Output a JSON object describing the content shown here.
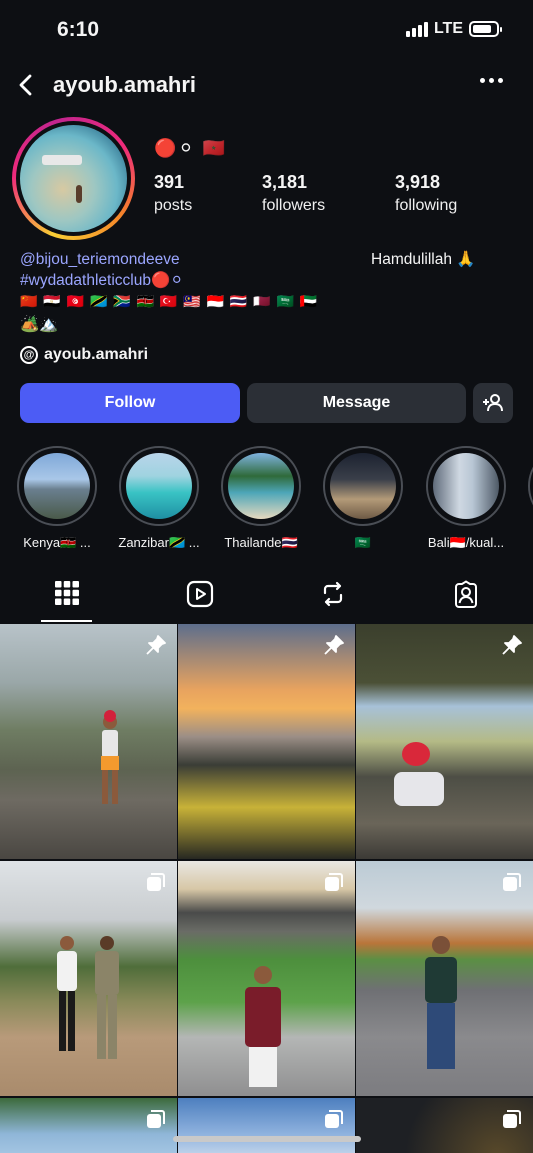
{
  "status": {
    "time": "6:10",
    "network": "LTE",
    "battery_level": 0.8
  },
  "header": {
    "username": "ayoub.amahri"
  },
  "profile": {
    "badges": "🔴⚪ 🇲🇦",
    "stats": [
      {
        "value": "391",
        "label": "posts"
      },
      {
        "value": "3,181",
        "label": "followers"
      },
      {
        "value": "3,918",
        "label": "following"
      }
    ],
    "bio_mention": "@bijou_teriemondeeve",
    "bio_right": "Hamdulillah 🙏",
    "bio_hashtag": "#wydadathleticclub🔴⚪",
    "bio_flags": "🇨🇳 🇪🇬 🇹🇳 🇹🇿 🇿🇦 🇰🇪 🇹🇷 🇲🇾 🇮🇩 🇹🇭 🇶🇦 🇸🇦 🇦🇪",
    "bio_emojis": "🏕️🏔️",
    "threads_handle": "ayoub.amahri"
  },
  "actions": {
    "follow": "Follow",
    "message": "Message"
  },
  "highlights": [
    {
      "label": "Kenya🇰🇪 ..."
    },
    {
      "label": "Zanzibar🇹🇿 ..."
    },
    {
      "label": "Thailande🇹🇭"
    },
    {
      "label": "🇸🇦"
    },
    {
      "label": "Bali🇮🇩/kual..."
    }
  ],
  "tabs": [
    "grid-tab",
    "reels-tab",
    "reposts-tab",
    "tagged-tab"
  ],
  "posts": [
    {
      "pinned": true
    },
    {
      "pinned": true
    },
    {
      "pinned": true
    },
    {
      "pinned": false
    },
    {
      "pinned": false
    },
    {
      "pinned": false
    },
    {
      "pinned": false
    },
    {
      "pinned": false
    },
    {
      "pinned": false
    }
  ],
  "colors": {
    "accent": "#4c5cf5",
    "background": "#0d0f13",
    "link": "#9ba6ff"
  }
}
